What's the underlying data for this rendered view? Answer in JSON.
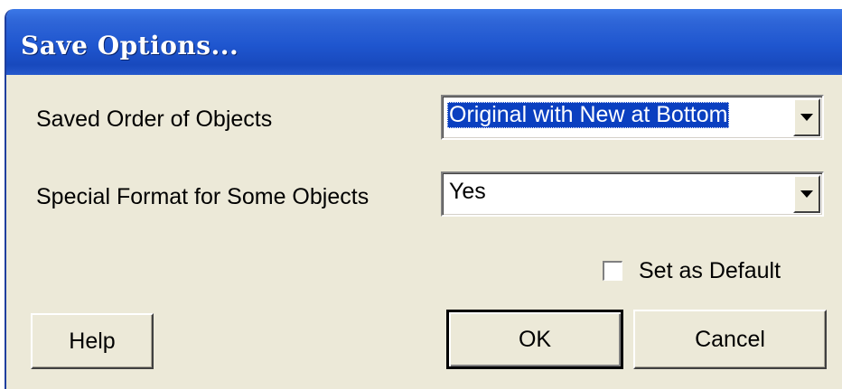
{
  "dialog": {
    "title": "Save Options..."
  },
  "fields": {
    "saved_order_label": "Saved Order of Objects",
    "saved_order_value": "Original with New at Bottom",
    "special_format_label": "Special Format for Some Objects",
    "special_format_value": "Yes"
  },
  "set_default": {
    "label": "Set as Default",
    "checked": false
  },
  "buttons": {
    "help": "Help",
    "ok": "OK",
    "cancel": "Cancel"
  }
}
